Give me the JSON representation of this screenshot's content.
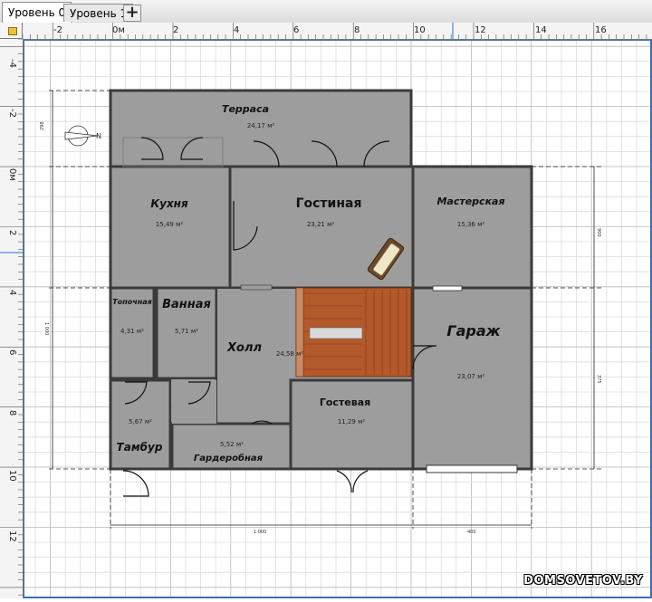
{
  "tabs": [
    {
      "label": "Уровень 0",
      "active": true
    },
    {
      "label": "Уровень 1",
      "active": false
    }
  ],
  "add_tab_label": "+",
  "ruler": {
    "h_labels": [
      "-2",
      "0м",
      "2",
      "4",
      "6",
      "8",
      "10",
      "12",
      "14",
      "16"
    ],
    "v_labels": [
      "-4",
      "-2",
      "0м",
      "2",
      "4",
      "6",
      "8",
      "10",
      "12"
    ]
  },
  "rooms": {
    "terrace": {
      "name": "Терраса",
      "area": "24,17 м²"
    },
    "kitchen": {
      "name": "Кухня",
      "area": "15,49 м²"
    },
    "living": {
      "name": "Гостиная",
      "area": "23,21 м²"
    },
    "workshop": {
      "name": "Мастерская",
      "area": "15,36 м²"
    },
    "boiler": {
      "name": "Топочная",
      "area": "4,31 м²"
    },
    "bathroom": {
      "name": "Ванная",
      "area": "5,71 м²"
    },
    "hall": {
      "name": "Холл",
      "area": "24,58 м²"
    },
    "garage": {
      "name": "Гараж",
      "area": "23,07 м²"
    },
    "guest": {
      "name": "Гостевая",
      "area": "11,29 м²"
    },
    "vestibule": {
      "name": "Тамбур",
      "area": "5,67 м²"
    },
    "wardrobe": {
      "name": "Гардеробная",
      "area": "5,52 м²"
    }
  },
  "dimensions": {
    "top_left": "298",
    "left_total": "1 000",
    "right_upper": "900",
    "right_lower": "375",
    "bottom_main": "1 000",
    "bottom_right": "400"
  },
  "compass_label": "N",
  "watermark": "DOMSOVETOV.BY",
  "colors": {
    "room_fill": "#9d9d9d",
    "wall": "#3a3a3a",
    "stairs": "#b4592a",
    "grid": "#cfcfcf"
  }
}
